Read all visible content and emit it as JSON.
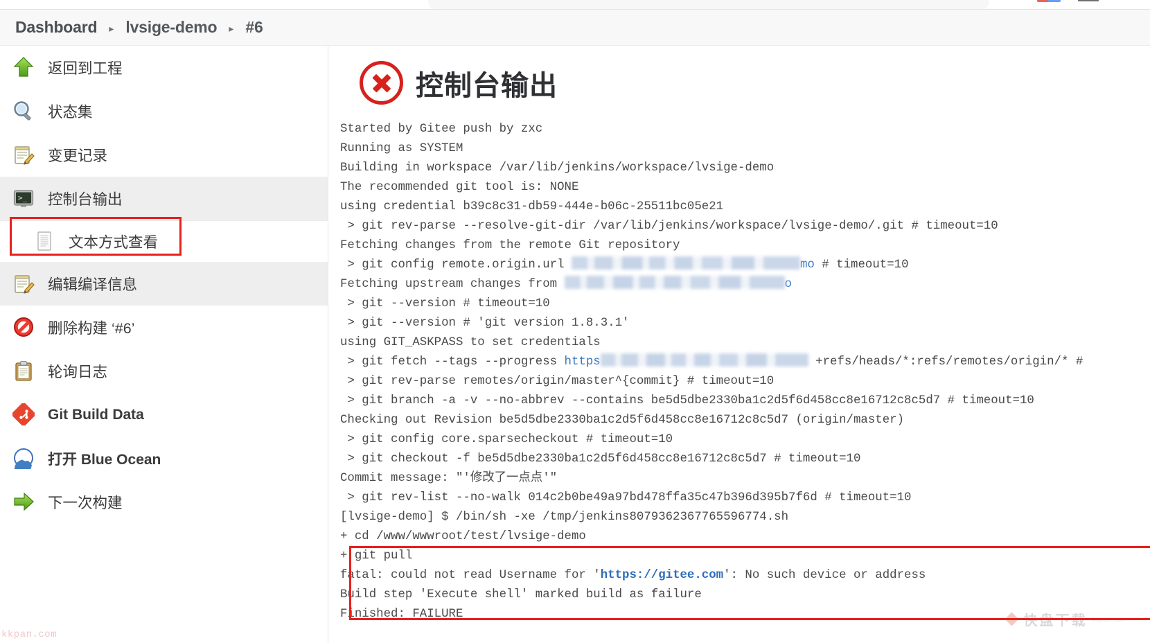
{
  "breadcrumb": {
    "items": [
      "Dashboard",
      "lvsige-demo",
      "#6"
    ],
    "separator": "▸"
  },
  "sidebar": {
    "items": [
      {
        "label": "返回到工程",
        "icon": "up-arrow-green-icon",
        "sub": false,
        "bold": false,
        "shaded": false
      },
      {
        "label": "状态集",
        "icon": "magnifier-icon",
        "sub": false,
        "bold": false,
        "shaded": false
      },
      {
        "label": "变更记录",
        "icon": "notepad-pencil-icon",
        "sub": false,
        "bold": false,
        "shaded": false
      },
      {
        "label": "控制台输出",
        "icon": "terminal-icon",
        "sub": false,
        "bold": false,
        "shaded": true
      },
      {
        "label": "文本方式查看",
        "icon": "document-icon",
        "sub": true,
        "bold": false,
        "shaded": false
      },
      {
        "label": "编辑编译信息",
        "icon": "notepad-pencil-icon",
        "sub": false,
        "bold": false,
        "shaded": true
      },
      {
        "label": "删除构建 ‘#6’",
        "icon": "no-entry-icon",
        "sub": false,
        "bold": false,
        "shaded": false
      },
      {
        "label": "轮询日志",
        "icon": "clipboard-icon",
        "sub": false,
        "bold": false,
        "shaded": false
      },
      {
        "label": "Git Build Data",
        "icon": "git-icon",
        "sub": false,
        "bold": true,
        "shaded": false
      },
      {
        "label": "打开 Blue Ocean",
        "icon": "blue-ocean-icon",
        "sub": false,
        "bold": true,
        "shaded": false
      },
      {
        "label": "下一次构建",
        "icon": "right-arrow-green-icon",
        "sub": false,
        "bold": false,
        "shaded": false
      }
    ],
    "selected_index": 3
  },
  "console": {
    "title": "控制台输出",
    "status_icon": "failure-x-icon",
    "lines": [
      {
        "t": "Started by Gitee push by zxc"
      },
      {
        "t": "Running as SYSTEM"
      },
      {
        "t": "Building in workspace /var/lib/jenkins/workspace/lvsige-demo"
      },
      {
        "t": "The recommended git tool is: NONE"
      },
      {
        "t": "using credential b39c8c31-db59-444e-b06c-25511bc05e21"
      },
      {
        "t": " > git rev-parse --resolve-git-dir /var/lib/jenkins/workspace/lvsige-demo/.git # timeout=10"
      },
      {
        "t": "Fetching changes from the remote Git repository"
      },
      {
        "pre": " > git config remote.origin.url ",
        "redact": "r1",
        "mid": "mo",
        "post": " # timeout=10"
      },
      {
        "pre": "Fetching upstream changes from ",
        "redact": "r2",
        "mid": "o",
        "post": ""
      },
      {
        "t": " > git --version # timeout=10"
      },
      {
        "t": " > git --version # 'git version 1.8.3.1'"
      },
      {
        "t": "using GIT_ASKPASS to set credentials"
      },
      {
        "pre": " > git fetch --tags --progress ",
        "link": "https",
        "redact": "r3",
        "post": " +refs/heads/*:refs/remotes/origin/* #"
      },
      {
        "t": " > git rev-parse remotes/origin/master^{commit} # timeout=10"
      },
      {
        "t": " > git branch -a -v --no-abbrev --contains be5d5dbe2330ba1c2d5f6d458cc8e16712c8c5d7 # timeout=10"
      },
      {
        "t": "Checking out Revision be5d5dbe2330ba1c2d5f6d458cc8e16712c8c5d7 (origin/master)"
      },
      {
        "t": " > git config core.sparsecheckout # timeout=10"
      },
      {
        "t": " > git checkout -f be5d5dbe2330ba1c2d5f6d458cc8e16712c8c5d7 # timeout=10"
      },
      {
        "t": "Commit message: \"'修改了一点点'\""
      },
      {
        "t": " > git rev-list --no-walk 014c2b0be49a97bd478ffa35c47b396d395b7f6d # timeout=10"
      },
      {
        "t": "[lvsige-demo] $ /bin/sh -xe /tmp/jenkins8079362367765596774.sh"
      },
      {
        "t": "+ cd /www/wwwroot/test/lvsige-demo"
      },
      {
        "t": "+ git pull"
      },
      {
        "pre": "fatal: could not read Username for '",
        "linkb": "https://gitee.com",
        "post": "': No such device or address"
      },
      {
        "t": "Build step 'Execute shell' marked build as failure"
      },
      {
        "t": "Finished: FAILURE"
      }
    ]
  },
  "watermarks": {
    "left": "kkpan.com",
    "right_title": "快盘下载",
    "right_sub": "kkpan.com"
  },
  "colors": {
    "error_red": "#e8201b",
    "link_blue": "#3b78c4",
    "accent_green": "#5aa817"
  }
}
